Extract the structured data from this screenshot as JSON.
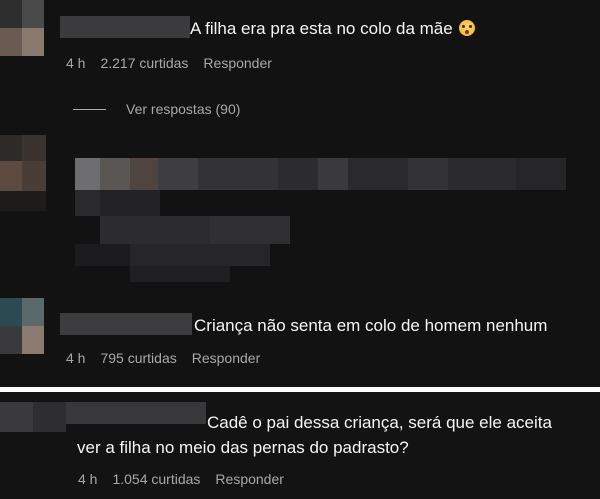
{
  "comments": [
    {
      "text": "A filha era pra esta no colo da mãe",
      "emoji_icon": "flushed-face-emoji",
      "time": "4 h",
      "likes": "2.217 curtidas",
      "reply_label": "Responder",
      "view_replies_label": "Ver respostas (90)"
    },
    {
      "text": "Criança não senta em colo de homem nenhum",
      "time": "4 h",
      "likes": "795 curtidas",
      "reply_label": "Responder"
    },
    {
      "text_line1": "Cadê o pai dessa criança, será que ele aceita",
      "text_line2": "ver a filha no meio das pernas do padrasto?",
      "time": "4 h",
      "likes": "1.054 curtidas",
      "reply_label": "Responder"
    }
  ],
  "colors": {
    "background": "#121212",
    "text": "#f5f5f5",
    "meta_text": "#a8a8a8",
    "divider": "#ffffff"
  }
}
